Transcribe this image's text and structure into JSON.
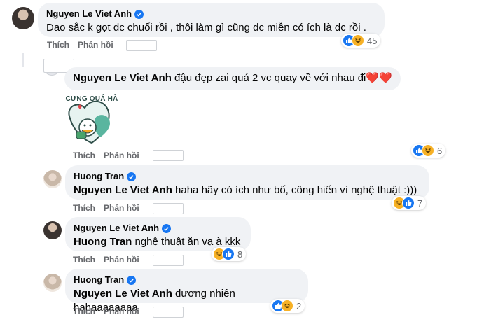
{
  "comments": [
    {
      "author": "Nguyen Le Viet Anh",
      "verified": true,
      "text": "Dao sắc k gọt dc chuối rồi , thôi làm gì cũng dc miễn có ích là dc rồi .",
      "actions": {
        "like": "Thích",
        "reply": "Phản hồi"
      },
      "reactions": {
        "icons": [
          "like-icon",
          "haha-icon"
        ],
        "count": "45"
      }
    },
    {
      "author": "",
      "mention": "Nguyen Le Viet Anh",
      "text": " đậu đẹp zai quá 2 vc quay về với nhau đi",
      "emoji": "❤️❤️",
      "sticker": {
        "caption": "CƯNG QUÁ HÀ"
      },
      "actions": {
        "like": "Thích",
        "reply": "Phản hồi"
      },
      "reactions": {
        "icons": [
          "like-icon",
          "haha-icon"
        ],
        "count": "6"
      }
    },
    {
      "author": "Huong Tran",
      "verified": true,
      "mention": "Nguyen Le Viet Anh",
      "text": " haha hãy có ích như bố, công hiến vì nghệ thuật :)))",
      "actions": {
        "like": "Thích",
        "reply": "Phản hồi"
      },
      "reactions": {
        "icons": [
          "haha-icon",
          "like-icon"
        ],
        "count": "7"
      }
    },
    {
      "author": "Nguyen Le Viet Anh",
      "verified": true,
      "mention": "Huong Tran",
      "text": " nghệ thuật ăn vạ à kkk",
      "actions": {
        "like": "Thích",
        "reply": "Phản hồi"
      },
      "reactions": {
        "icons": [
          "haha-icon",
          "like-icon"
        ],
        "count": "8"
      }
    },
    {
      "author": "Huong Tran",
      "verified": true,
      "mention": "Nguyen Le Viet Anh",
      "text": " đương nhiên hahaaaaaaaa",
      "actions": {
        "like": "Thích",
        "reply": "Phản hồi"
      },
      "reactions": {
        "icons": [
          "like-icon",
          "haha-icon"
        ],
        "count": "2"
      }
    }
  ],
  "colors": {
    "like": "#1877f2",
    "haha": "#f7b125",
    "bubble": "#f0f2f5",
    "meta": "#65676b"
  }
}
